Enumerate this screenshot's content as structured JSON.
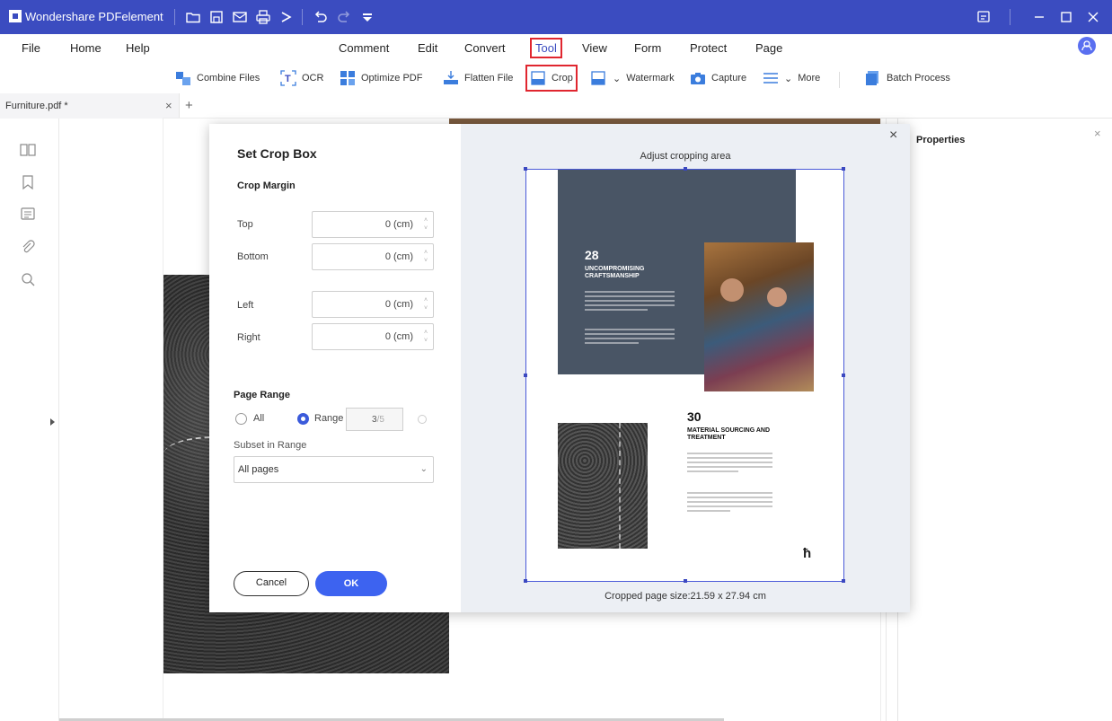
{
  "titlebar": {
    "app_title": "Wondershare PDFelement",
    "colors": {
      "bar": "#3b4cc0"
    },
    "icons": [
      "open-folder-icon",
      "save-icon",
      "mail-icon",
      "print-icon",
      "share-icon",
      "undo-icon",
      "redo-icon",
      "customize-dropdown-icon"
    ],
    "window_icons": [
      "feedback-icon",
      "minimize-icon",
      "maximize-icon",
      "close-icon"
    ]
  },
  "menu": {
    "items": [
      "File",
      "Home",
      "Help",
      "Comment",
      "Edit",
      "Convert",
      "Tool",
      "View",
      "Form",
      "Protect",
      "Page"
    ],
    "active": "Tool"
  },
  "toolbar": {
    "combine": "Combine Files",
    "ocr": "OCR",
    "optimize": "Optimize PDF",
    "flatten": "Flatten File",
    "crop": "Crop",
    "watermark": "Watermark",
    "capture": "Capture",
    "more": "More",
    "batch": "Batch Process"
  },
  "tabs": {
    "doc_name": "Furniture.pdf *",
    "close_glyph": "×",
    "add_glyph": "+"
  },
  "sidebar": {
    "icons": [
      "thumbnails-icon",
      "bookmark-icon",
      "comment-icon",
      "attachment-icon",
      "search-icon"
    ]
  },
  "properties": {
    "title": "Properties",
    "close_glyph": "×"
  },
  "dialog": {
    "title": "Set Crop Box",
    "crop_margin": "Crop Margin",
    "top_label": "Top",
    "bottom_label": "Bottom",
    "left_label": "Left",
    "right_label": "Right",
    "margin_value": "0 (cm)",
    "spin_up": "˄",
    "spin_down": "˅",
    "page_range": "Page Range",
    "all_label": "All",
    "range_label": "Range",
    "range_value": "3",
    "range_total": "/5",
    "subset_label": "Subset in Range",
    "subset_value": "All pages",
    "chevron": "⌄",
    "cancel": "Cancel",
    "ok": "OK",
    "close_glyph": "×",
    "adjust_label": "Adjust cropping area",
    "cropped_size": "Cropped page size:21.59 x 27.94 cm"
  },
  "preview": {
    "top_number": "28",
    "top_heading": "UNCOMPROMISING CRAFTSMANSHIP",
    "bottom_number": "30",
    "bottom_heading": "MATERIAL SOURCING AND TREATMENT",
    "logo_glyph": "ħ"
  }
}
